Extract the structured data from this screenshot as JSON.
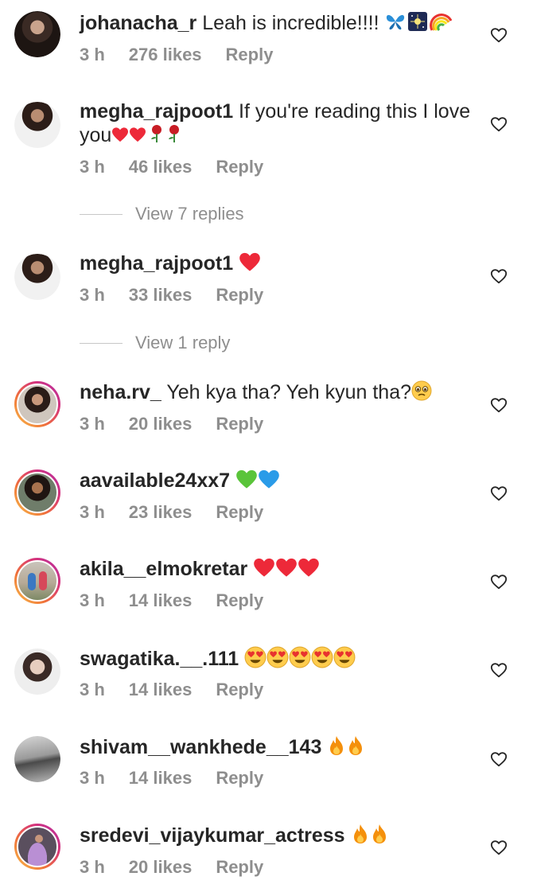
{
  "comments": [
    {
      "username": "johanacha_r",
      "text": " Leah is incredible!!!! ",
      "emojis": [
        "butterfly-emoji",
        "night-sky-emoji",
        "rainbow-emoji"
      ],
      "time": "3 h",
      "likes": "276 likes",
      "reply": "Reply"
    },
    {
      "username": "megha_rajpoot1",
      "text": " If you're reading this I love you",
      "emojis": [
        "red-heart-emoji",
        "red-heart-emoji",
        "rose-emoji",
        "rose-emoji"
      ],
      "time": "3 h",
      "likes": "46 likes",
      "reply": "Reply"
    },
    {
      "username": "megha_rajpoot1",
      "text": " ",
      "emojis": [
        "red-heart-emoji"
      ],
      "time": "3 h",
      "likes": "33 likes",
      "reply": "Reply"
    },
    {
      "username": "neha.rv_",
      "text": " Yeh kya tha? Yeh kyun tha?",
      "emojis": [
        "pleading-face-emoji"
      ],
      "time": "3 h",
      "likes": "20 likes",
      "reply": "Reply"
    },
    {
      "username": "aavailable24xx7",
      "text": " ",
      "emojis": [
        "green-heart-emoji",
        "blue-heart-emoji"
      ],
      "time": "3 h",
      "likes": "23 likes",
      "reply": "Reply"
    },
    {
      "username": "akila__elmokretar",
      "text": " ",
      "emojis": [
        "red-heart-emoji",
        "red-heart-emoji",
        "red-heart-emoji"
      ],
      "time": "3 h",
      "likes": "14 likes",
      "reply": "Reply"
    },
    {
      "username": "swagatika.__.111",
      "text": " ",
      "emojis": [
        "heart-eyes-emoji",
        "heart-eyes-emoji",
        "heart-eyes-emoji",
        "heart-eyes-emoji",
        "heart-eyes-emoji"
      ],
      "time": "3 h",
      "likes": "14 likes",
      "reply": "Reply"
    },
    {
      "username": "shivam__wankhede__143",
      "text": " ",
      "emojis": [
        "fire-emoji",
        "fire-emoji"
      ],
      "time": "3 h",
      "likes": "14 likes",
      "reply": "Reply"
    },
    {
      "username": "sredevi_vijaykumar_actress",
      "text": " ",
      "emojis": [
        "fire-emoji",
        "fire-emoji"
      ],
      "time": "3 h",
      "likes": "20 likes",
      "reply": "Reply"
    }
  ],
  "view_replies": [
    "View 7 replies",
    "View 1 reply"
  ],
  "colors": {
    "text": "#262626",
    "secondary": "#8e8e8e",
    "heart_red": "#ed2939",
    "story_ring_start": "#f9c14a",
    "story_ring_end": "#b02fa6"
  }
}
